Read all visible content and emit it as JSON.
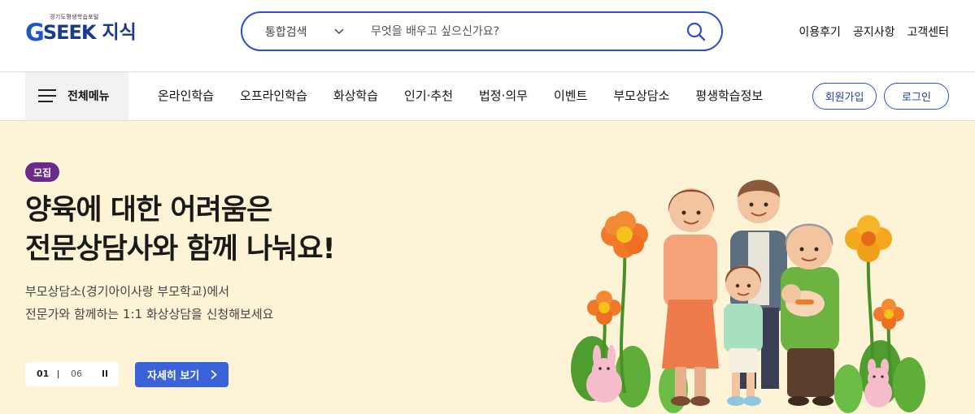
{
  "header": {
    "logo": {
      "sub": "경기도평생학습포털",
      "g": "G",
      "seek": "SEEK",
      "jisik": "지식"
    },
    "search": {
      "category": "통합검색",
      "placeholder": "무엇을 배우고 싶으신가요?",
      "value": ""
    },
    "util_links": [
      "이용후기",
      "공지사항",
      "고객센터"
    ]
  },
  "gnb": {
    "all_menu_label": "전체메뉴",
    "items": [
      "온라인학습",
      "오프라인학습",
      "화상학습",
      "인기·추천",
      "법정·의무",
      "이벤트",
      "부모상담소",
      "평생학습정보"
    ],
    "join_label": "회원가입",
    "login_label": "로그인"
  },
  "hero": {
    "badge": "모집",
    "title_line1": "양육에 대한 어려움은",
    "title_line2": "전문상담사와 함께 나눠요!",
    "desc_line1": "부모상담소(경기아이사랑 부모학교)에서",
    "desc_line2": "전문가와 함께하는 1:1 화상상담을 신청해보세요",
    "pager": {
      "current": "01",
      "total": "06"
    },
    "detail_label": "자세히 보기"
  },
  "colors": {
    "brand_blue": "#2c50c8",
    "hero_bg": "#fdf3d6",
    "badge_purple": "#6b2b8a",
    "cta_blue": "#3b63d9"
  },
  "icons": [
    "menu-icon",
    "search-icon",
    "chevron-down-icon",
    "pause-icon",
    "chevron-right-icon"
  ]
}
